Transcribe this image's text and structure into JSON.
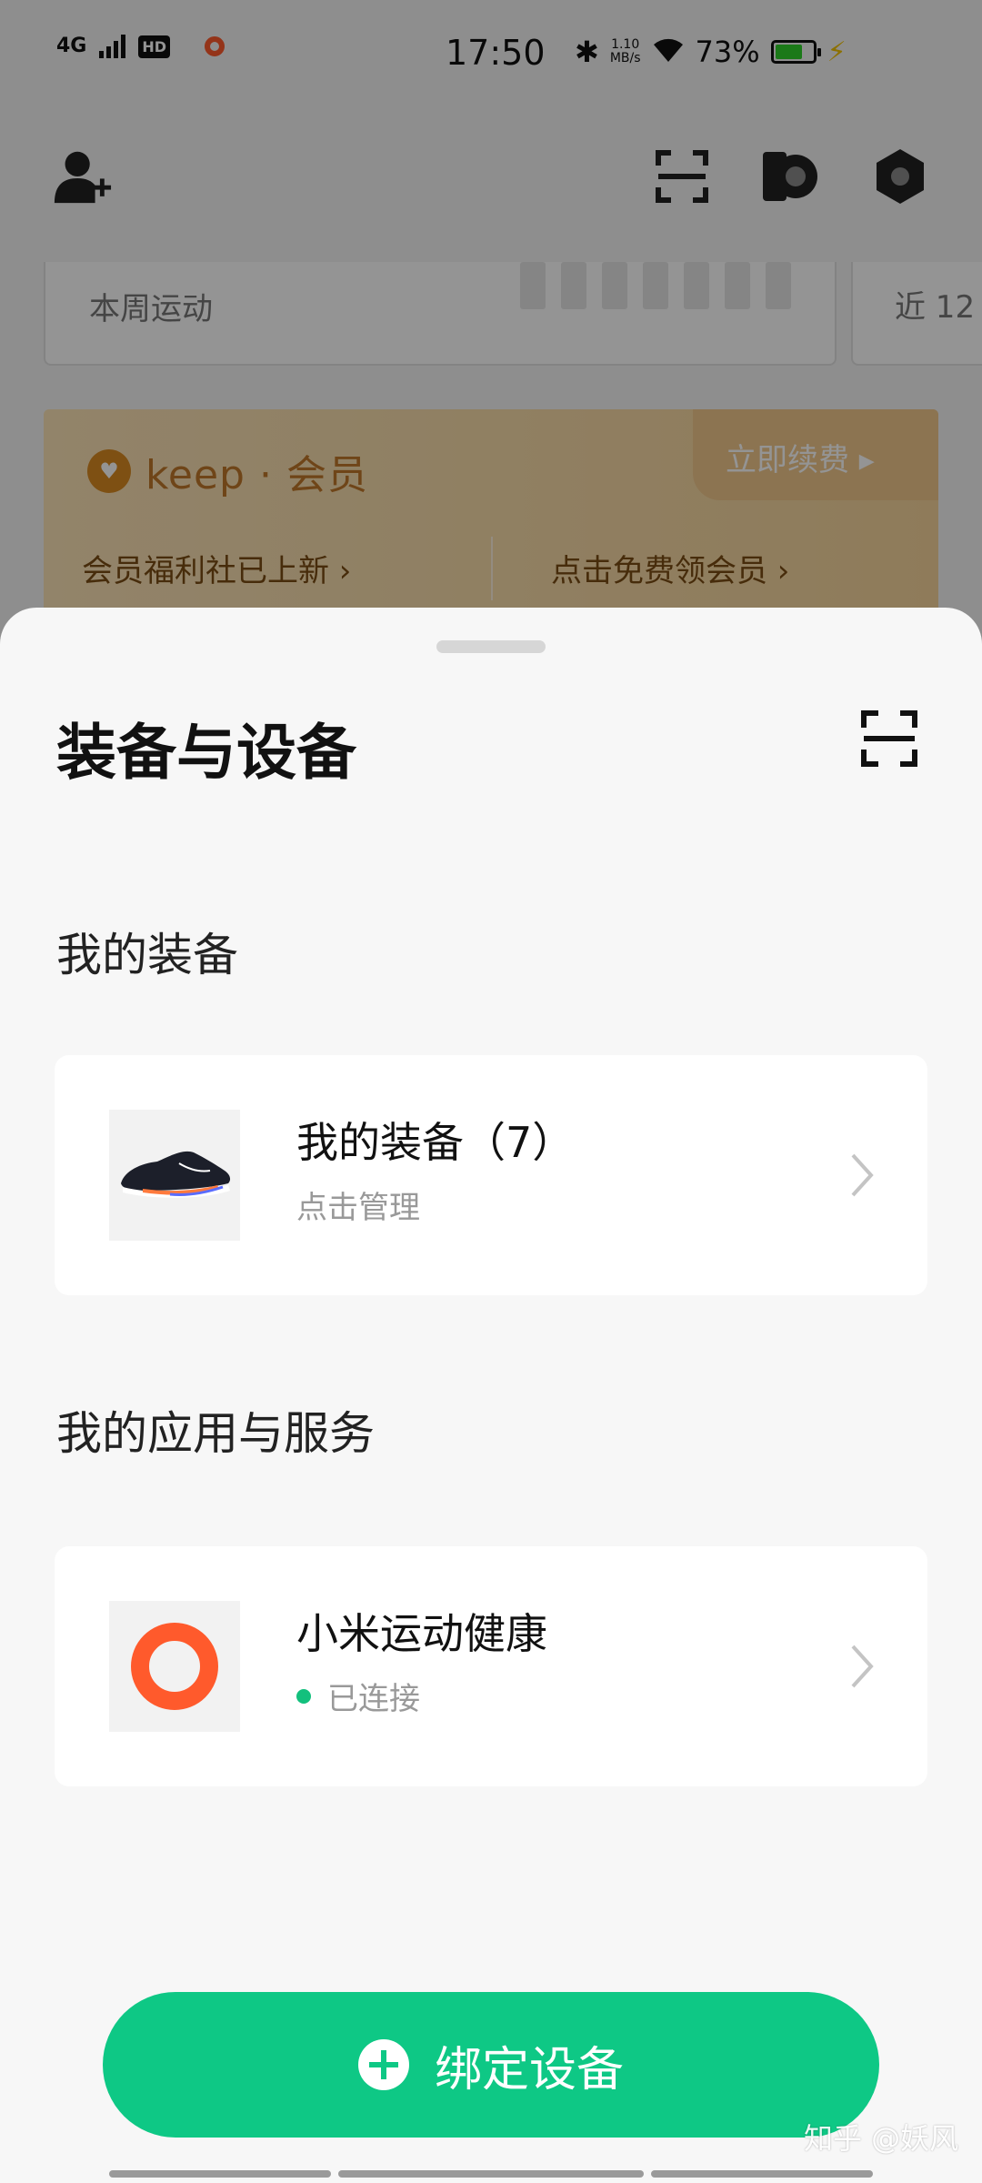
{
  "status_bar": {
    "network": "4G",
    "hd": "HD",
    "time": "17:50",
    "speed_value": "1.10",
    "speed_unit": "MB/s",
    "battery": "73%"
  },
  "background": {
    "week_label": "本周运动",
    "month_label": "近 12",
    "vip_brand": "keep · 会员",
    "vip_renew": "立即续费 ▸",
    "vip_welfare": "会员福利社已上新 ›",
    "vip_free": "点击免费领会员 ›"
  },
  "sheet": {
    "title": "装备与设备",
    "gear_section": "我的装备",
    "gear_card": {
      "title": "我的装备（7）",
      "subtitle": "点击管理"
    },
    "apps_section": "我的应用与服务",
    "app_card": {
      "title": "小米运动健康",
      "status": "已连接"
    },
    "bind_button": "绑定设备"
  },
  "watermark": "知乎 @妖风",
  "colors": {
    "accent": "#0ec885",
    "connected_dot": "#13c07d",
    "xiaomi_ring": "#ff5a2c"
  }
}
